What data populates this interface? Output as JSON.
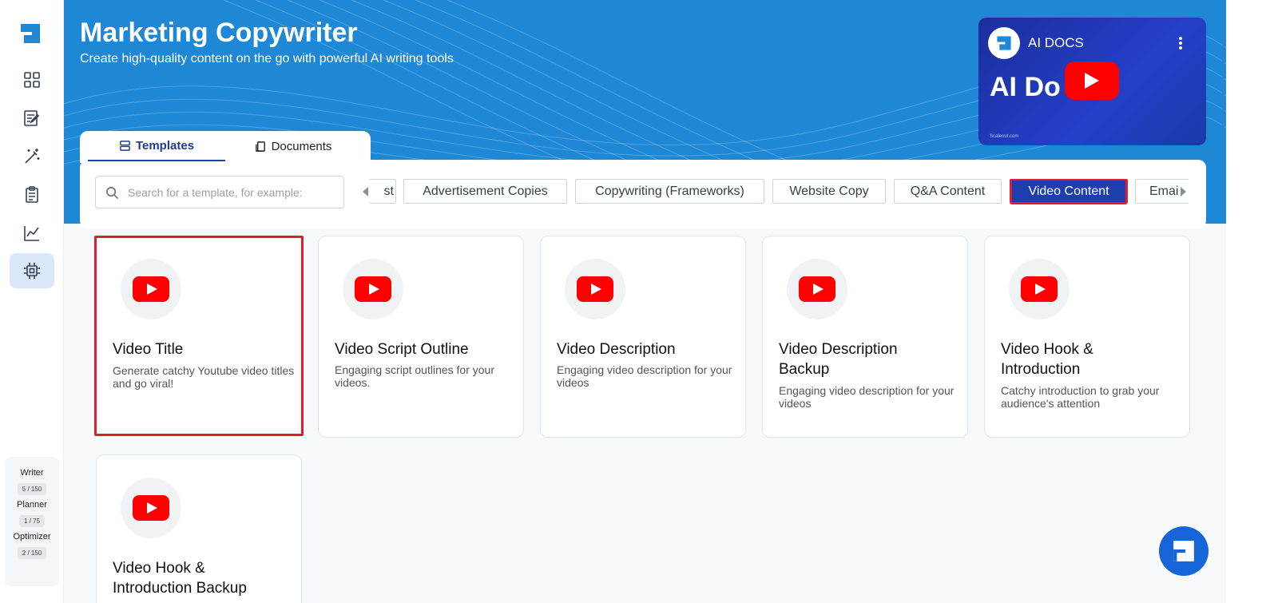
{
  "hero": {
    "title": "Marketing Copywriter",
    "subtitle": "Create high-quality content on the go with powerful AI writing tools"
  },
  "video": {
    "channel": "AI DOCS",
    "big_text": "AI Do",
    "footer": "Scalenut.com"
  },
  "tabs": [
    {
      "label": "Templates",
      "icon": "templates-icon",
      "active": true
    },
    {
      "label": "Documents",
      "icon": "documents-icon",
      "active": false
    }
  ],
  "search": {
    "placeholder": "Search for a template, for example:"
  },
  "categories": [
    {
      "label": "st",
      "active": false
    },
    {
      "label": "Advertisement Copies",
      "active": false
    },
    {
      "label": "Copywriting (Frameworks)",
      "active": false
    },
    {
      "label": "Website Copy",
      "active": false
    },
    {
      "label": "Q&A Content",
      "active": false
    },
    {
      "label": "Video Content",
      "active": true
    },
    {
      "label": "Emai",
      "active": false
    }
  ],
  "cards": [
    {
      "title": "Video Title",
      "desc": "Generate catchy Youtube video titles and go viral!",
      "icon": "youtube-icon",
      "selected": true
    },
    {
      "title": "Video Script Outline",
      "desc": "Engaging script outlines for your videos.",
      "icon": "youtube-icon",
      "selected": false
    },
    {
      "title": "Video Description",
      "desc": "Engaging video description for your videos",
      "icon": "youtube-icon",
      "selected": false
    },
    {
      "title": "Video Description Backup",
      "desc": "Engaging video description for your videos",
      "icon": "youtube-icon",
      "selected": false
    },
    {
      "title": "Video Hook & Introduction",
      "desc": "Catchy introduction to grab your audience's attention",
      "icon": "youtube-icon",
      "selected": false
    },
    {
      "title": "Video Hook & Introduction Backup",
      "desc": "",
      "icon": "youtube-icon",
      "selected": false
    }
  ],
  "sidebar": {
    "nav": [
      "dashboard-icon",
      "editor-icon",
      "magic-wand-icon",
      "clipboard-icon",
      "chart-icon",
      "chip-icon"
    ],
    "usage": [
      {
        "label": "Writer",
        "count": "5 / 150"
      },
      {
        "label": "Planner",
        "count": "1 / 75"
      },
      {
        "label": "Optimizer",
        "count": "2 / 150"
      }
    ]
  },
  "colors": {
    "brand": "#1e88d6",
    "accent": "#1d3fae",
    "selected_border": "#e11d2e",
    "youtube": "#ff0000"
  }
}
